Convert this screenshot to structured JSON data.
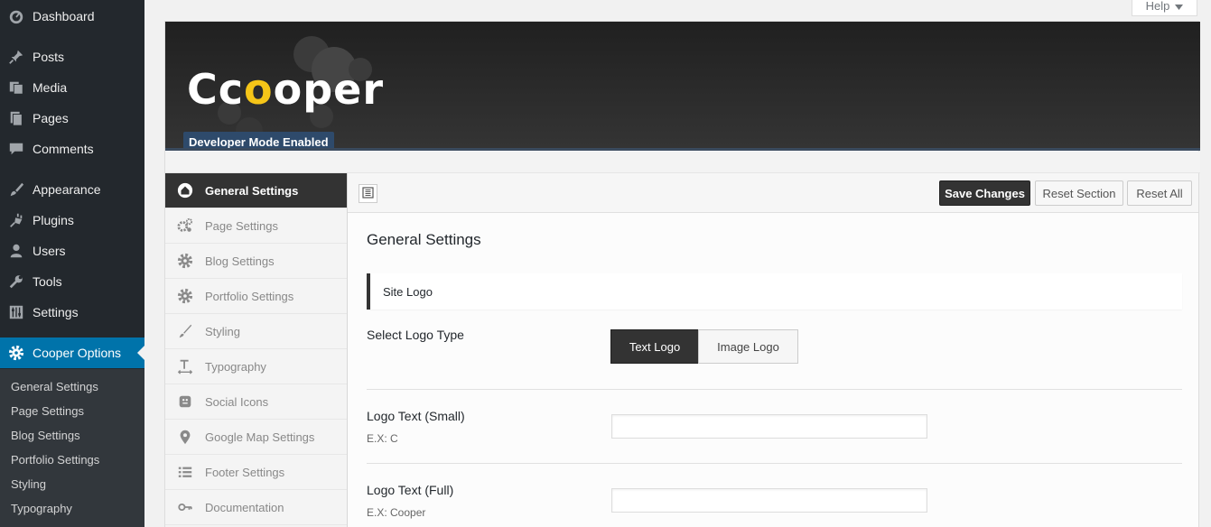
{
  "help_label": "Help",
  "admin_menu": {
    "items": [
      {
        "label": "Dashboard",
        "icon": "dashboard-icon"
      },
      {
        "label": "Posts",
        "icon": "pin-icon"
      },
      {
        "label": "Media",
        "icon": "media-icon"
      },
      {
        "label": "Pages",
        "icon": "pages-icon"
      },
      {
        "label": "Comments",
        "icon": "comment-icon"
      },
      {
        "label": "Appearance",
        "icon": "brush-icon"
      },
      {
        "label": "Plugins",
        "icon": "plugin-icon"
      },
      {
        "label": "Users",
        "icon": "user-icon"
      },
      {
        "label": "Tools",
        "icon": "wrench-icon"
      },
      {
        "label": "Settings",
        "icon": "sliders-icon"
      },
      {
        "label": "Cooper Options",
        "icon": "gear-icon"
      }
    ],
    "submenu": [
      "General Settings",
      "Page Settings",
      "Blog Settings",
      "Portfolio Settings",
      "Styling",
      "Typography"
    ]
  },
  "header": {
    "logo_pre": "Cc",
    "logo_accent": "o",
    "logo_post": "oper",
    "dev_badge": "Developer Mode Enabled",
    "accent_color": "#f5c518"
  },
  "sections": [
    {
      "label": "General Settings",
      "icon": "home-icon"
    },
    {
      "label": "Page Settings",
      "icon": "cogs-icon"
    },
    {
      "label": "Blog Settings",
      "icon": "gear-icon"
    },
    {
      "label": "Portfolio Settings",
      "icon": "gear-icon"
    },
    {
      "label": "Styling",
      "icon": "brush-icon"
    },
    {
      "label": "Typography",
      "icon": "text-height-icon"
    },
    {
      "label": "Social Icons",
      "icon": "smiley-icon"
    },
    {
      "label": "Google Map Settings",
      "icon": "map-marker-icon"
    },
    {
      "label": "Footer Settings",
      "icon": "list-icon"
    },
    {
      "label": "Documentation",
      "icon": "key-icon"
    }
  ],
  "toolbar": {
    "save_label": "Save Changes",
    "reset_section_label": "Reset Section",
    "reset_all_label": "Reset All"
  },
  "content": {
    "title": "General Settings",
    "site_logo_heading": "Site Logo",
    "logo_type": {
      "label": "Select Logo Type",
      "options": [
        "Text Logo",
        "Image Logo"
      ],
      "selected": "Text Logo"
    },
    "logo_small": {
      "label": "Logo Text (Small)",
      "desc": "E.X: C",
      "value": ""
    },
    "logo_full": {
      "label": "Logo Text (Full)",
      "desc": "E.X: Cooper",
      "value": ""
    }
  }
}
